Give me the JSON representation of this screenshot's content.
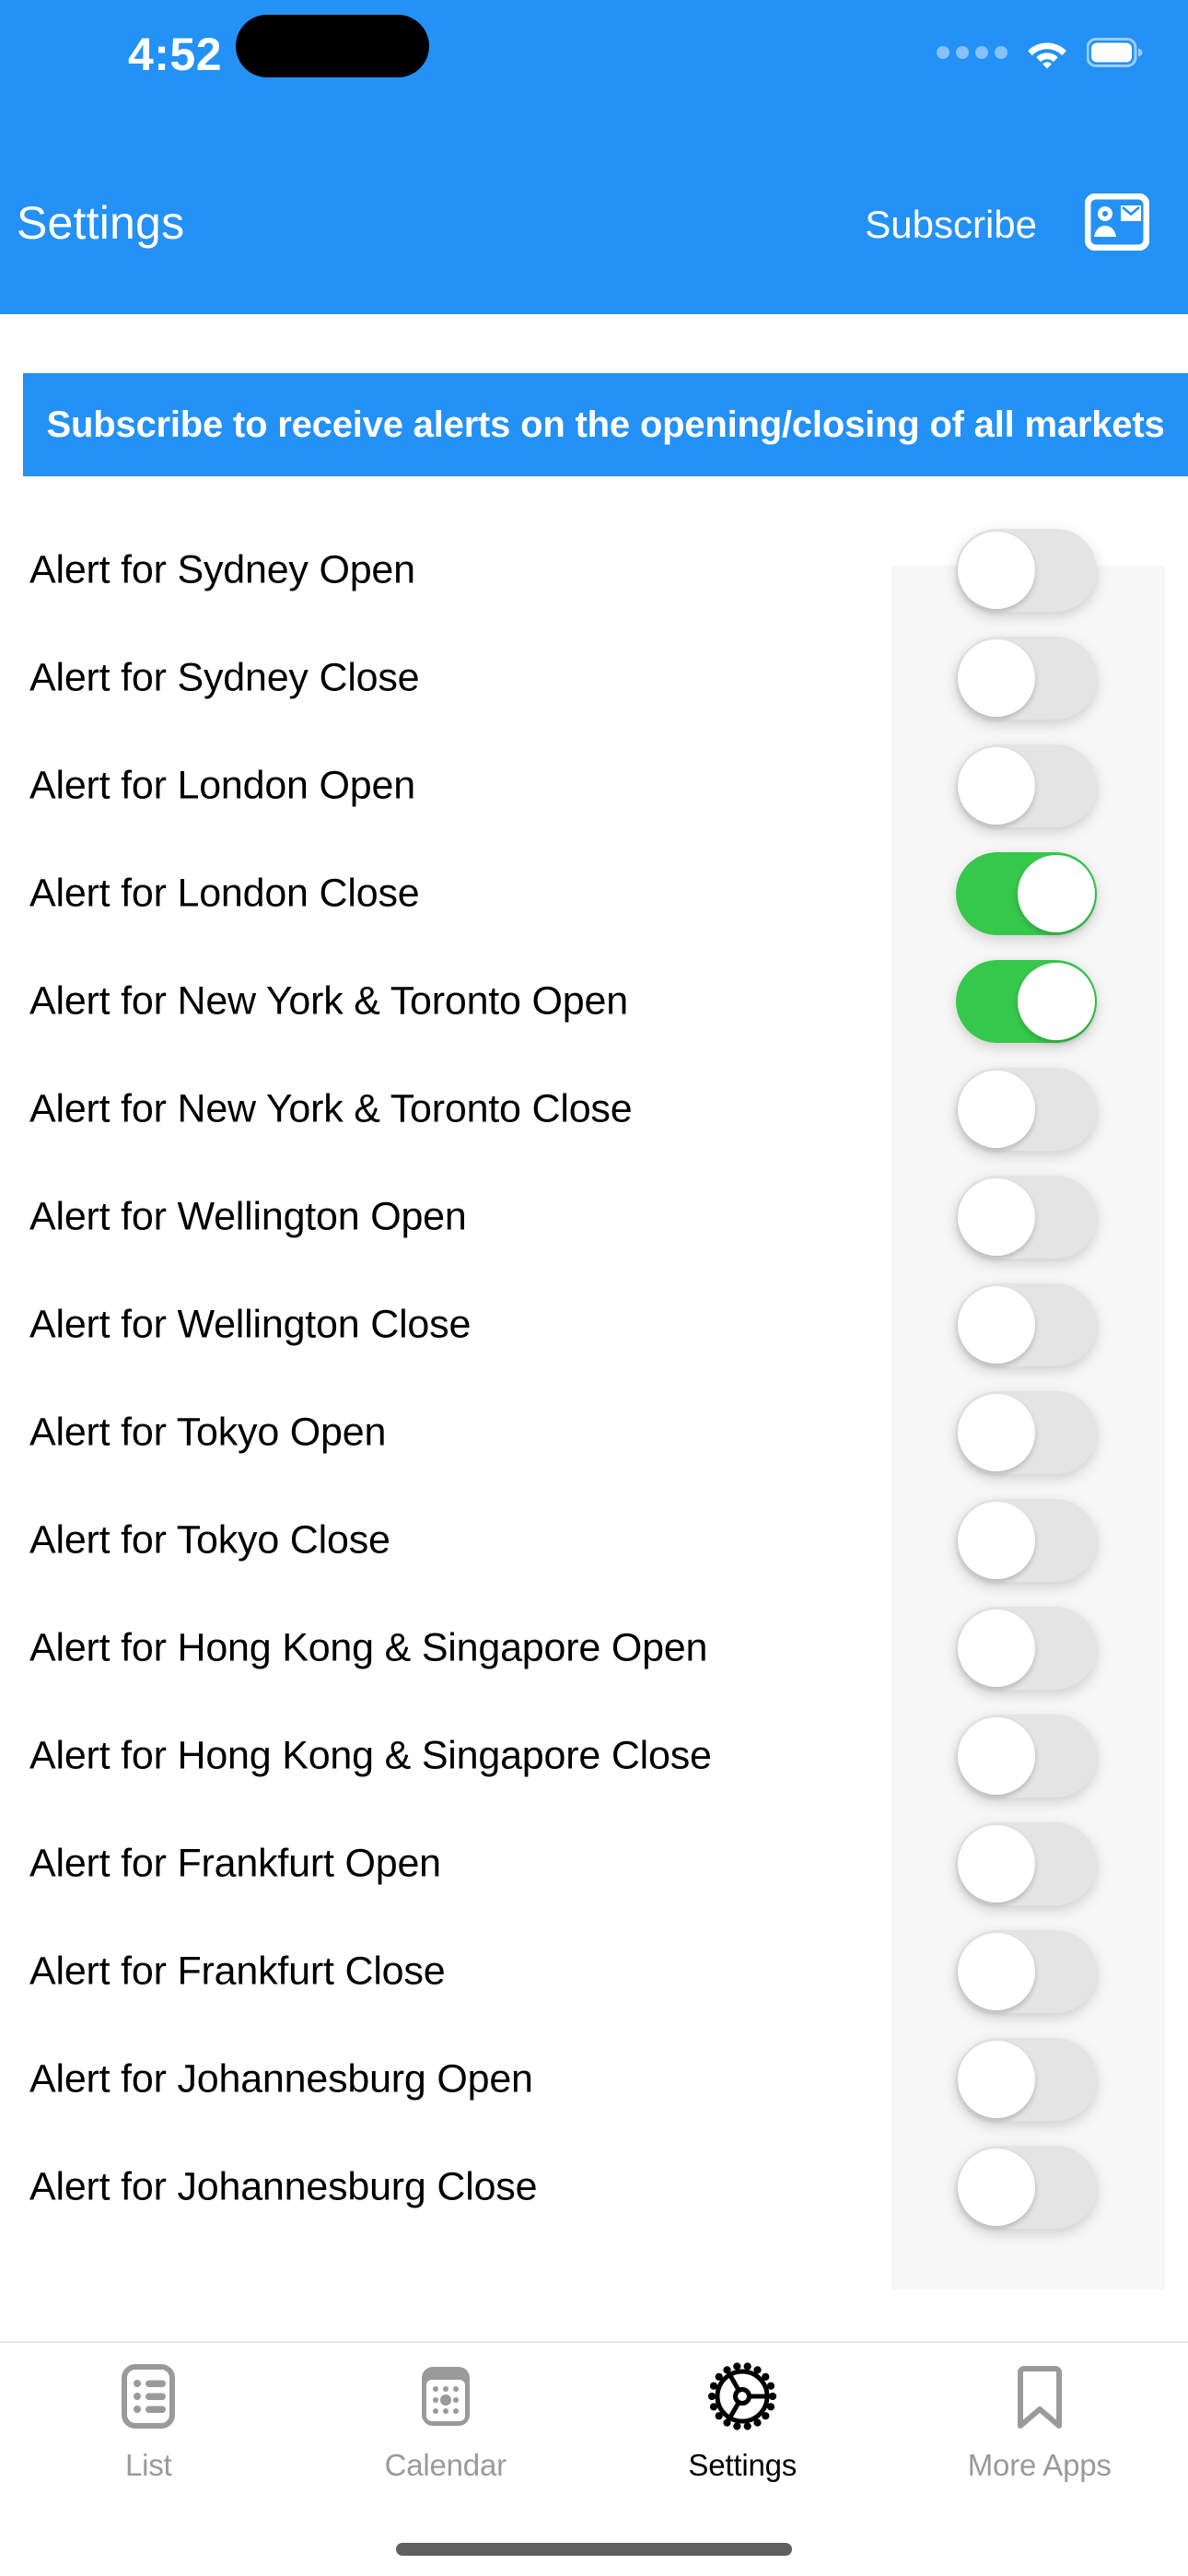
{
  "status_bar": {
    "time": "4:52",
    "signal_icon": "signal-dots-icon",
    "wifi_icon": "wifi-icon",
    "battery_icon": "battery-full-icon"
  },
  "header": {
    "title": "Settings",
    "subscribe_label": "Subscribe",
    "contact_icon": "contact-card-icon",
    "background_color": "#2391f5"
  },
  "promo_banner": {
    "text": "Subscribe to receive alerts on the opening/closing of all markets",
    "background_color": "#2391f5",
    "text_color": "#ffffff"
  },
  "colors": {
    "accent_blue": "#2391f5",
    "toggle_on_green": "#35c84b",
    "toggle_off_gray": "#e4e4e4",
    "toggle_column_bg": "#f7f7f7",
    "tab_inactive": "#9a9a9a",
    "tab_active": "#000000"
  },
  "alerts": [
    {
      "label": "Alert for Sydney Open",
      "enabled": false
    },
    {
      "label": "Alert for Sydney Close",
      "enabled": false
    },
    {
      "label": "Alert for London Open",
      "enabled": false
    },
    {
      "label": "Alert for London Close",
      "enabled": true
    },
    {
      "label": "Alert for New York & Toronto Open",
      "enabled": true
    },
    {
      "label": "Alert for New York & Toronto Close",
      "enabled": false
    },
    {
      "label": "Alert for Wellington Open",
      "enabled": false
    },
    {
      "label": "Alert for Wellington Close",
      "enabled": false
    },
    {
      "label": "Alert for Tokyo Open",
      "enabled": false
    },
    {
      "label": "Alert for Tokyo Close",
      "enabled": false
    },
    {
      "label": "Alert for Hong Kong & Singapore Open",
      "enabled": false
    },
    {
      "label": "Alert for Hong Kong & Singapore Close",
      "enabled": false
    },
    {
      "label": "Alert for Frankfurt Open",
      "enabled": false
    },
    {
      "label": "Alert for Frankfurt Close",
      "enabled": false
    },
    {
      "label": "Alert for Johannesburg Open",
      "enabled": false
    },
    {
      "label": "Alert for Johannesburg Close",
      "enabled": false
    }
  ],
  "tab_bar": {
    "items": [
      {
        "label": "List",
        "icon": "list-icon",
        "active": false
      },
      {
        "label": "Calendar",
        "icon": "calendar-icon",
        "active": false
      },
      {
        "label": "Settings",
        "icon": "gear-icon",
        "active": true
      },
      {
        "label": "More Apps",
        "icon": "bookmark-icon",
        "active": false
      }
    ]
  }
}
